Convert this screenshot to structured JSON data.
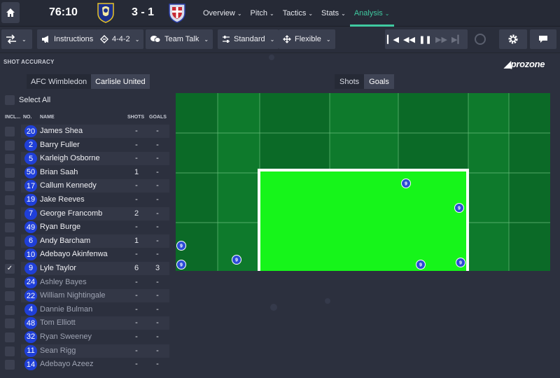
{
  "topbar": {
    "clock": "76:10",
    "score": "3 - 1",
    "nav": [
      {
        "label": "Overview",
        "active": false
      },
      {
        "label": "Pitch",
        "active": false
      },
      {
        "label": "Tactics",
        "active": false
      },
      {
        "label": "Stats",
        "active": false
      },
      {
        "label": "Analysis",
        "active": true
      }
    ]
  },
  "toolbar": {
    "instructions": "Instructions",
    "formation": "4-4-2",
    "team_talk": "Team Talk",
    "mentality": "Standard",
    "shape": "Flexible"
  },
  "panel": {
    "title": "SHOT ACCURACY",
    "brand": "prozone",
    "team_tabs": [
      "AFC Wimbledon",
      "Carlisle United"
    ],
    "active_team": "Carlisle United",
    "view_tabs": [
      "Shots",
      "Goals"
    ],
    "active_view": "Goals",
    "select_all": "Select All",
    "columns": {
      "incl": "INCL...",
      "no": "NO.",
      "name": "NAME",
      "shots": "SHOTS",
      "goals": "GOALS"
    }
  },
  "players": [
    {
      "no": "20",
      "name": "James Shea",
      "shots": "-",
      "goals": "-",
      "checked": false,
      "sub": false
    },
    {
      "no": "2",
      "name": "Barry Fuller",
      "shots": "-",
      "goals": "-",
      "checked": false,
      "sub": false
    },
    {
      "no": "5",
      "name": "Karleigh Osborne",
      "shots": "-",
      "goals": "-",
      "checked": false,
      "sub": false
    },
    {
      "no": "50",
      "name": "Brian Saah",
      "shots": "1",
      "goals": "-",
      "checked": false,
      "sub": false
    },
    {
      "no": "17",
      "name": "Callum Kennedy",
      "shots": "-",
      "goals": "-",
      "checked": false,
      "sub": false
    },
    {
      "no": "19",
      "name": "Jake Reeves",
      "shots": "-",
      "goals": "-",
      "checked": false,
      "sub": false
    },
    {
      "no": "7",
      "name": "George Francomb",
      "shots": "2",
      "goals": "-",
      "checked": false,
      "sub": false
    },
    {
      "no": "49",
      "name": "Ryan Burge",
      "shots": "-",
      "goals": "-",
      "checked": false,
      "sub": false
    },
    {
      "no": "6",
      "name": "Andy Barcham",
      "shots": "1",
      "goals": "-",
      "checked": false,
      "sub": false
    },
    {
      "no": "10",
      "name": "Adebayo Akinfenwa",
      "shots": "-",
      "goals": "-",
      "checked": false,
      "sub": false
    },
    {
      "no": "9",
      "name": "Lyle Taylor",
      "shots": "6",
      "goals": "3",
      "checked": true,
      "sub": false
    },
    {
      "no": "24",
      "name": "Ashley Bayes",
      "shots": "-",
      "goals": "-",
      "checked": false,
      "sub": true
    },
    {
      "no": "22",
      "name": "William Nightingale",
      "shots": "-",
      "goals": "-",
      "checked": false,
      "sub": true
    },
    {
      "no": "4",
      "name": "Dannie Bulman",
      "shots": "-",
      "goals": "-",
      "checked": false,
      "sub": true
    },
    {
      "no": "48",
      "name": "Tom Elliott",
      "shots": "-",
      "goals": "-",
      "checked": false,
      "sub": true
    },
    {
      "no": "32",
      "name": "Ryan Sweeney",
      "shots": "-",
      "goals": "-",
      "checked": false,
      "sub": true
    },
    {
      "no": "11",
      "name": "Sean Rigg",
      "shots": "-",
      "goals": "-",
      "checked": false,
      "sub": true
    },
    {
      "no": "14",
      "name": "Adebayo Azeez",
      "shots": "-",
      "goals": "-",
      "checked": false,
      "sub": true
    }
  ],
  "shot_markers": [
    {
      "label": "9",
      "target": "on"
    },
    {
      "label": "9",
      "target": "on"
    },
    {
      "label": "9",
      "target": "off"
    },
    {
      "label": "9",
      "target": "off"
    },
    {
      "label": "9",
      "target": "off"
    },
    {
      "label": "9",
      "target": "on"
    },
    {
      "label": "9",
      "target": "on"
    }
  ],
  "colors": {
    "accent": "#3fc9a0",
    "player_badge": "#1f3fd8",
    "goal_frame_fill": "#16f51a",
    "pitch_dark": "#0b6b28",
    "pitch_mid": "#0f8a32"
  }
}
